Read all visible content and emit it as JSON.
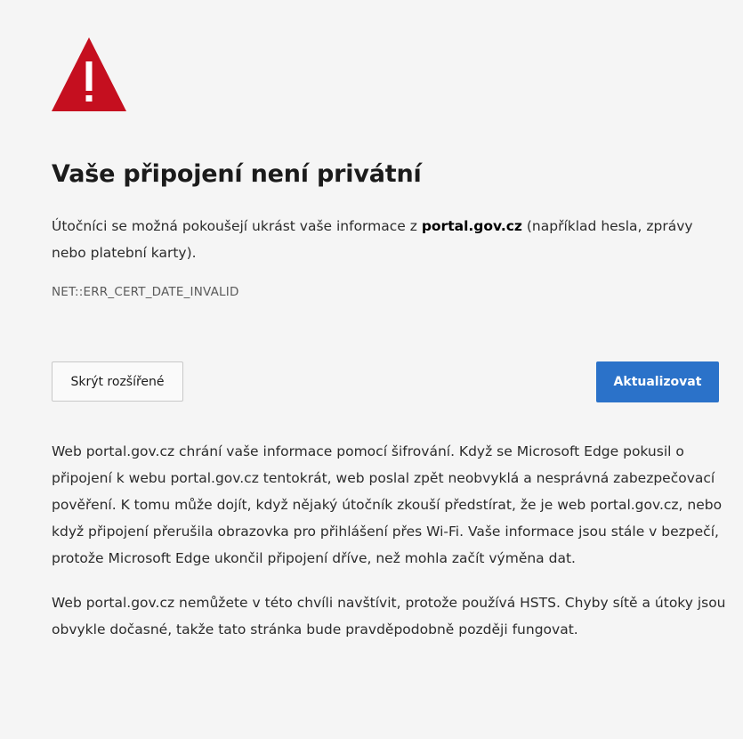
{
  "colors": {
    "background": "#f5f5f5",
    "warning_red": "#c50f1f",
    "primary_button": "#2b72c9"
  },
  "icon": "warning-triangle-icon",
  "title": "Vaše připojení není privátní",
  "intro": {
    "before": "Útočníci se možná pokoušejí ukrást vaše informace z ",
    "host": "portal.gov.cz",
    "after": " (například hesla, zprávy nebo platební karty)."
  },
  "error_code": "NET::ERR_CERT_DATE_INVALID",
  "buttons": {
    "hide_advanced": "Skrýt rozšířené",
    "reload": "Aktualizovat"
  },
  "details": {
    "paragraph1": "Web portal.gov.cz chrání vaše informace pomocí šifrování. Když se Microsoft Edge pokusil o připojení k webu portal.gov.cz tentokrát, web poslal zpět neobvyklá a nesprávná zabezpečovací pověření. K tomu může dojít, když nějaký útočník zkouší předstírat, že je web portal.gov.cz, nebo když připojení přerušila obrazovka pro přihlášení přes Wi-Fi. Vaše informace jsou stále v bezpečí, protože Microsoft Edge ukončil připojení dříve, než mohla začít výměna dat.",
    "paragraph2": "Web portal.gov.cz nemůžete v této chvíli navštívit, protože používá HSTS. Chyby sítě a útoky jsou obvykle dočasné, takže tato stránka bude pravděpodobně později fungovat."
  }
}
